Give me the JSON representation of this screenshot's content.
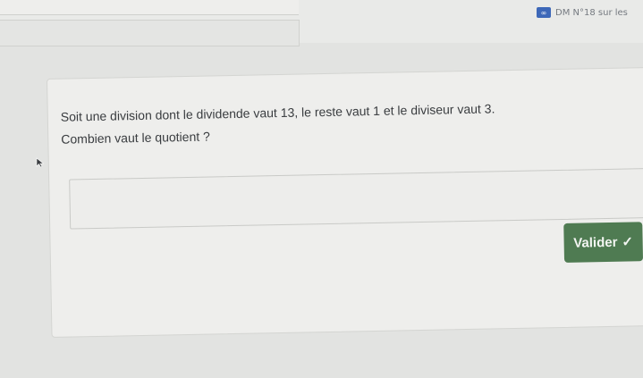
{
  "header": {
    "doc_icon": "link-icon",
    "doc_title": "DM N°18 sur les"
  },
  "exercise": {
    "question_line1": "Soit une division dont le dividende vaut 13, le reste vaut 1 et le diviseur vaut 3.",
    "question_line2": "Combien vaut le quotient ?",
    "answer_value": "",
    "validate_label": "Valider",
    "validate_icon": "checkmark-icon"
  },
  "colors": {
    "button_bg": "#4f7b52",
    "background": "#e2e3e1",
    "card": "#eeeeec"
  }
}
